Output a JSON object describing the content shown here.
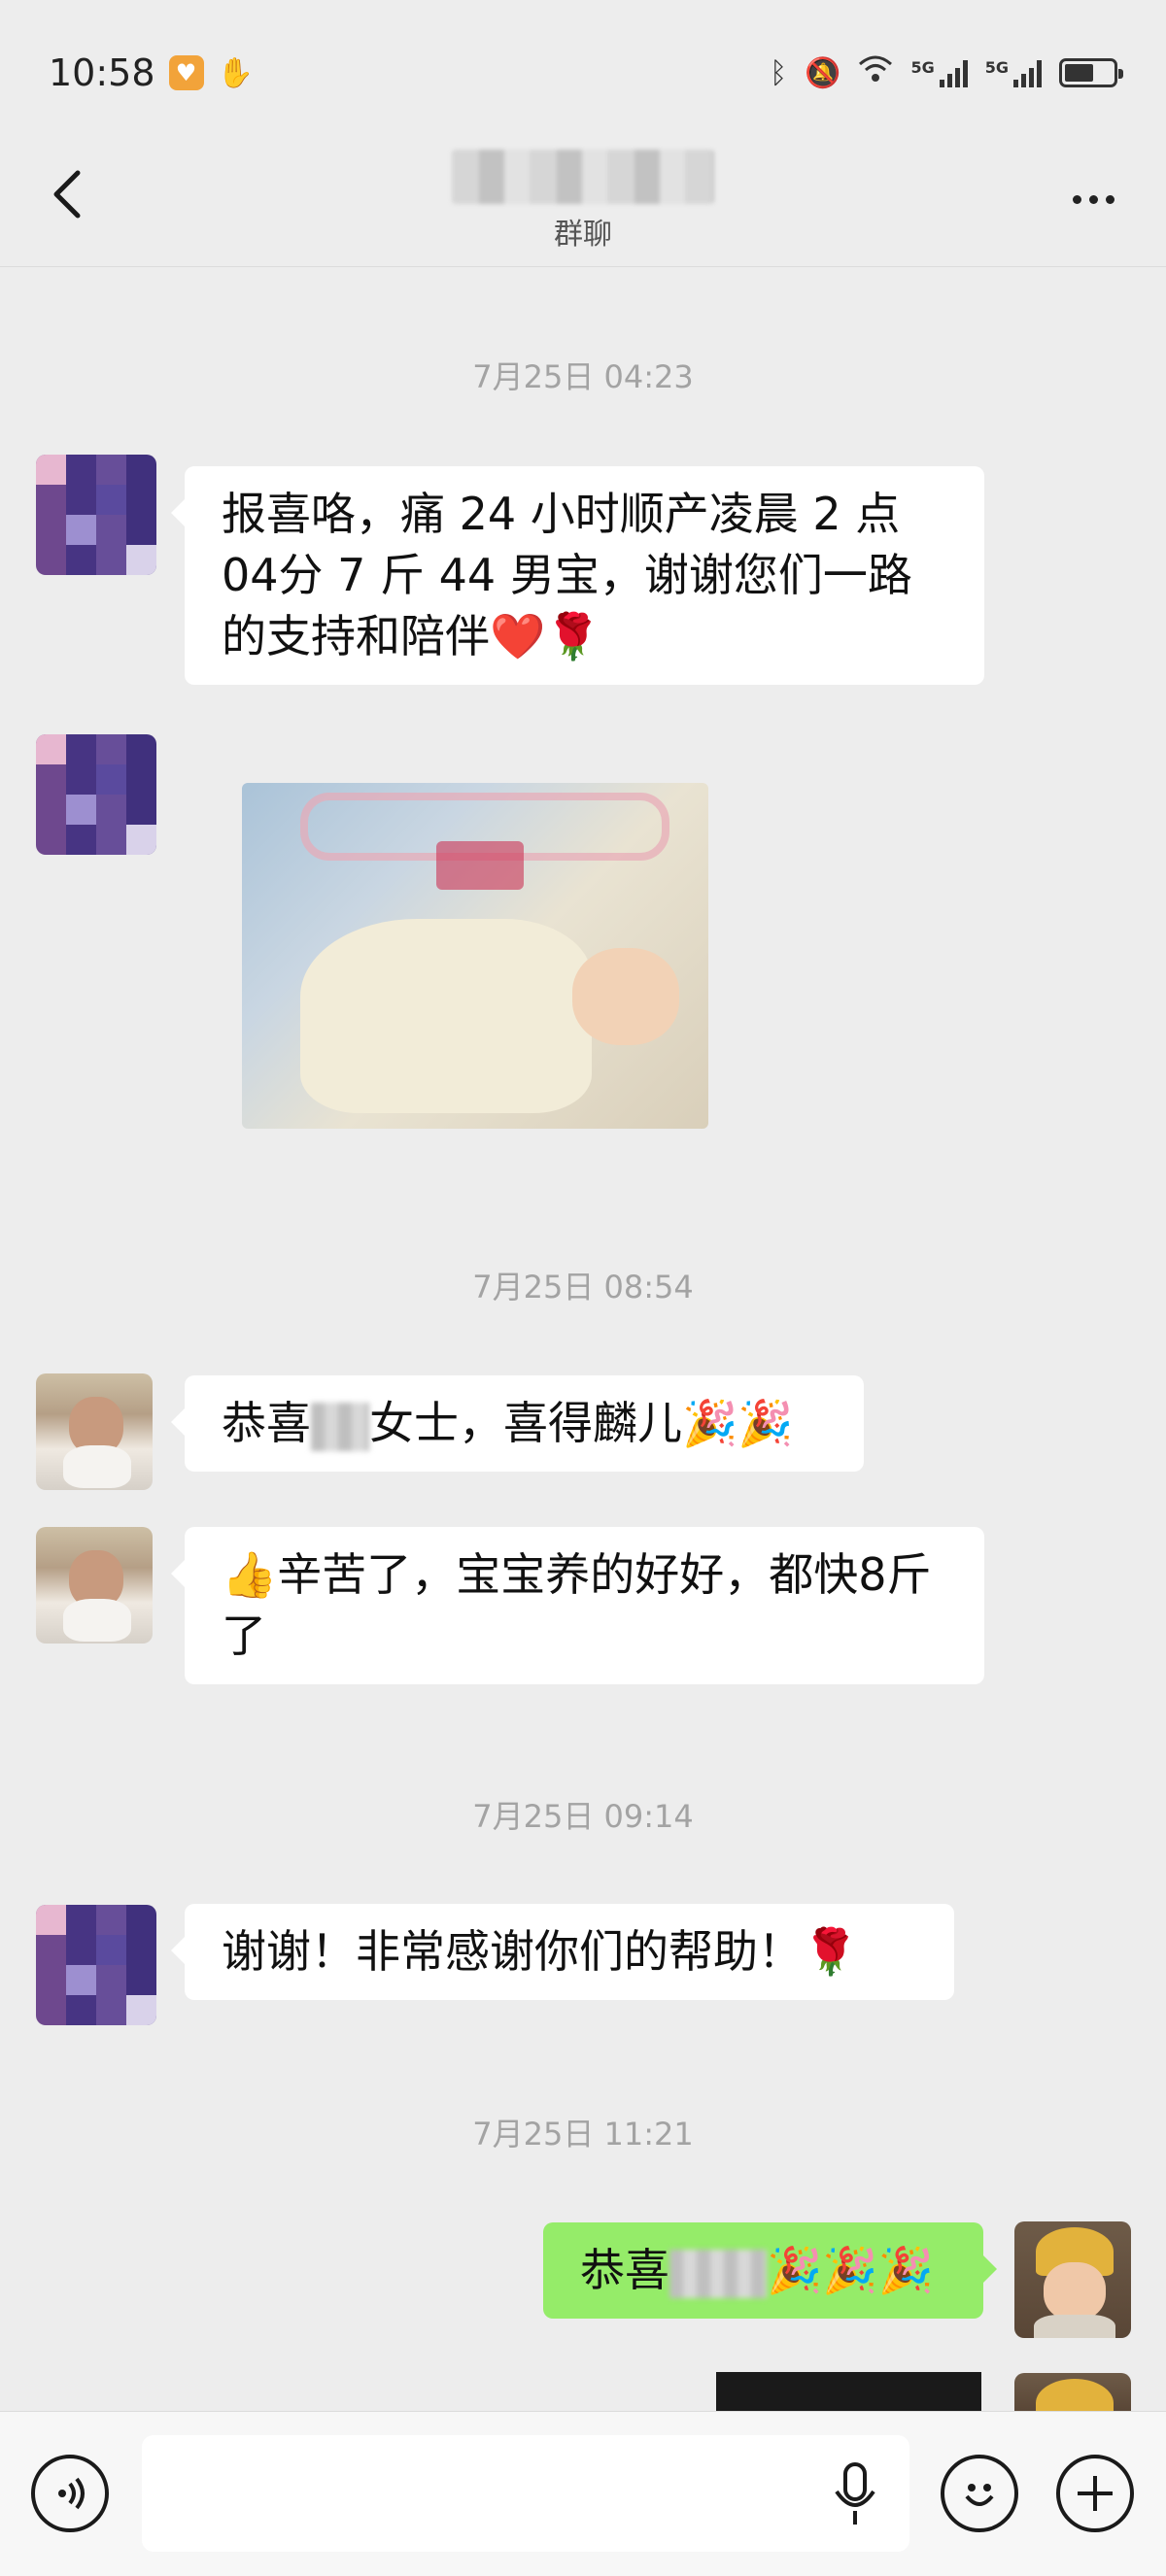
{
  "status_bar": {
    "time": "10:58",
    "network_1": "5G",
    "network_2": "5G"
  },
  "header": {
    "title": "",
    "subtitle": "群聊"
  },
  "messages": [
    {
      "timestamp": "7月25日 04:23"
    },
    {
      "text": "报喜咯，痛 24 小时顺产凌晨 2 点 04分 7 斤 44 男宝，谢谢您们一路的支持和陪伴❤️🌹"
    },
    {
      "text": ""
    },
    {
      "timestamp": "7月25日 08:54"
    },
    {
      "text_prefix": "恭喜",
      "text_suffix": "女士，喜得麟儿🎉🎉"
    },
    {
      "text": "👍辛苦了，宝宝养的好好，都快8斤了"
    },
    {
      "timestamp": "7月25日 09:14"
    },
    {
      "text": "谢谢！非常感谢你们的帮助！🌹"
    },
    {
      "timestamp": "7月25日 11:21"
    },
    {
      "text_prefix": "恭喜",
      "text_suffix": "🎉🎉🎉"
    }
  ],
  "input": {
    "placeholder": ""
  },
  "icons": {
    "back": "chevron-left-icon",
    "more": "more-dots-icon",
    "voice": "voice-icon",
    "mic": "mic-icon",
    "emoji": "emoji-icon",
    "plus": "plus-icon"
  },
  "colors": {
    "background": "#ededed",
    "my_bubble": "#95ec69",
    "other_bubble": "#ffffff",
    "timestamp": "#a3a3a3"
  }
}
